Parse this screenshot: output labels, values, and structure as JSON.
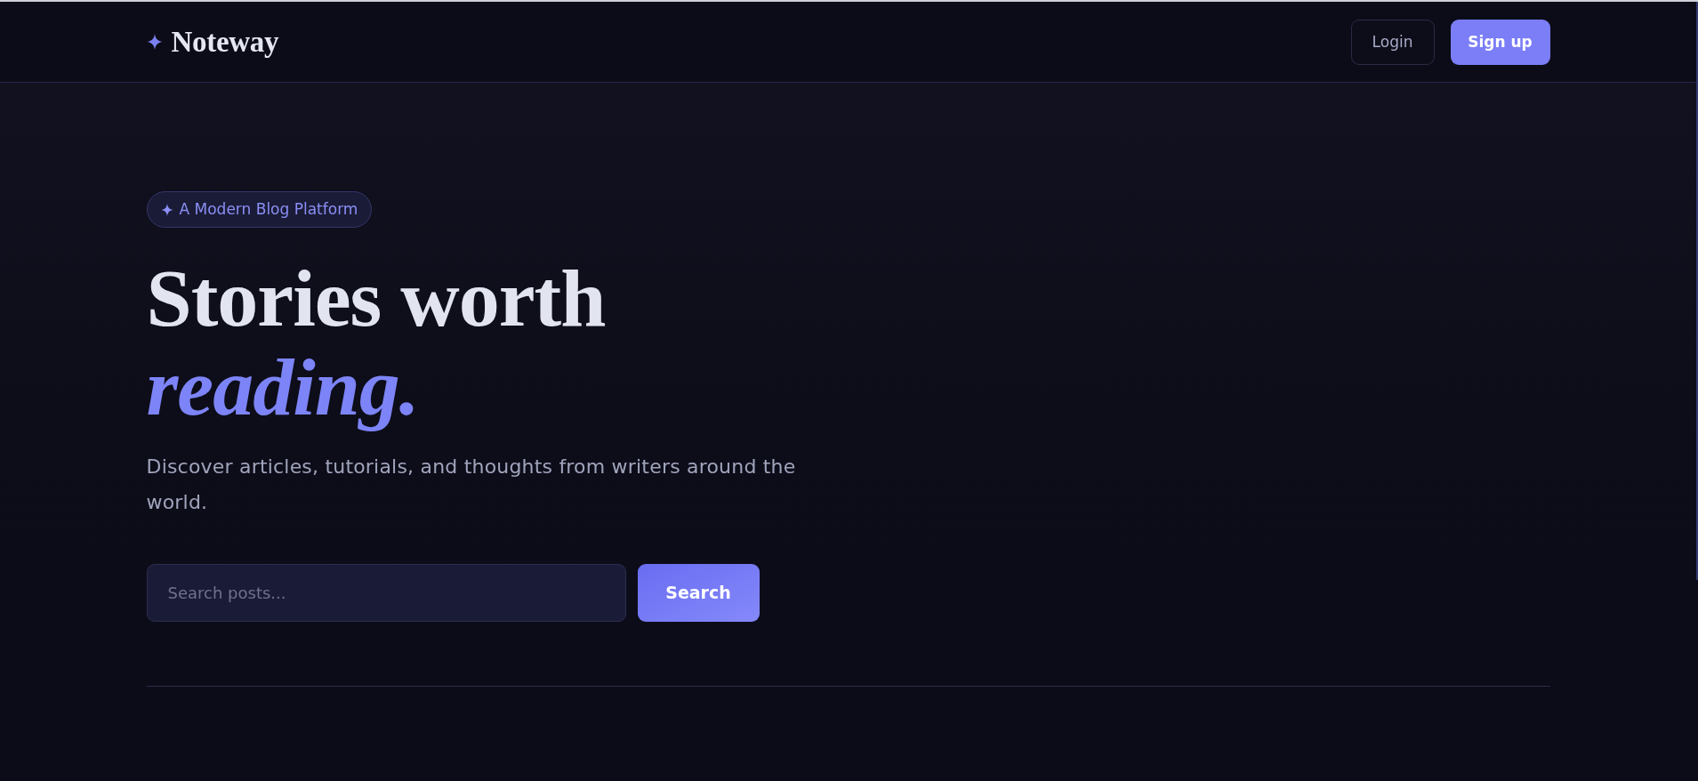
{
  "header": {
    "logo": "Noteway",
    "buttons": [
      {
        "label": "Login",
        "kind": "outline"
      },
      {
        "label": "Sign up",
        "kind": "primary"
      }
    ]
  },
  "hero": {
    "badge": "A Modern Blog Platform",
    "title": "Stories worth",
    "title_accent": "reading.",
    "description": "Discover articles, tutorials, and thoughts from writers around the world.",
    "search": {
      "placeholder": "Search posts...",
      "button": "Search"
    }
  }
}
